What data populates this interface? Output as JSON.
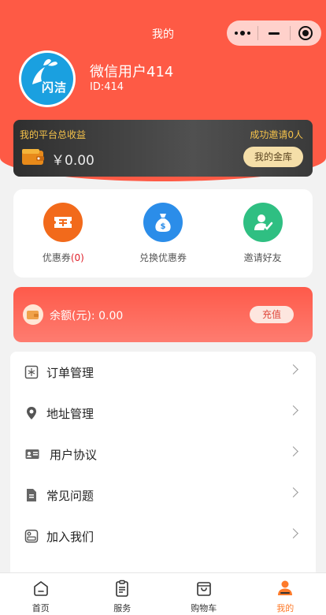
{
  "nav": {
    "title": "我的"
  },
  "profile": {
    "avatar_text": "闪洁",
    "name": "微信用户414",
    "id_text": "ID:414"
  },
  "earnings": {
    "title": "我的平台总收益",
    "invite_text": "成功邀请0人",
    "amount": "￥0.00",
    "vault_label": "我的金库"
  },
  "coupons": {
    "coupon_label": "优惠券",
    "coupon_count": "(0)",
    "exchange_label": "兑换优惠券",
    "invite_label": "邀请好友"
  },
  "balance": {
    "text": "余额(元): 0.00",
    "recharge_label": "充值"
  },
  "menu": {
    "items": [
      {
        "label": "订单管理",
        "icon": "order-icon"
      },
      {
        "label": "地址管理",
        "icon": "location-pin-icon"
      },
      {
        "label": "用户协议",
        "icon": "id-card-icon"
      },
      {
        "label": "常见问题",
        "icon": "document-icon"
      },
      {
        "label": "加入我们",
        "icon": "join-icon"
      }
    ]
  },
  "tabbar": {
    "items": [
      {
        "label": "首页",
        "icon": "home-icon"
      },
      {
        "label": "服务",
        "icon": "clipboard-icon"
      },
      {
        "label": "购物车",
        "icon": "shopping-bag-icon"
      },
      {
        "label": "我的",
        "icon": "user-icon"
      }
    ],
    "active": "我的"
  },
  "colors": {
    "header": "#fe5a45",
    "gold": "#f5c24a",
    "accent": "#fe7a2a",
    "coupon_orange": "#f26a1b",
    "exchange_blue": "#2b8de9",
    "invite_green": "#2fbf82"
  }
}
